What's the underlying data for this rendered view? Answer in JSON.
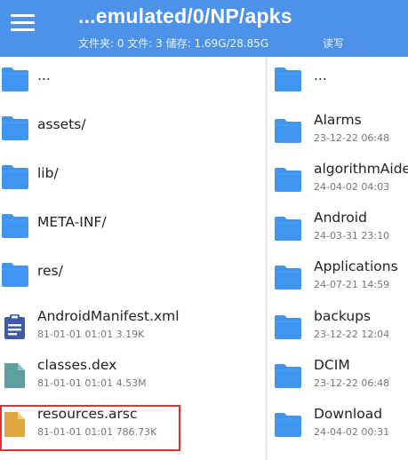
{
  "header": {
    "menu_icon": "hamburger-menu-icon",
    "path": "...emulated/0/NP/apks",
    "info": "文件夹: 0 文件: 3 储存: 1.69G/28.85G",
    "rw": "读写",
    "colors": {
      "bar": "#4C92EA",
      "folder": "#3F95F0",
      "manifest": "#3E5BA8",
      "dex": "#5E9EA0",
      "arsc": "#E0A63E",
      "highlight": "#E0322F"
    }
  },
  "left": {
    "items": [
      {
        "name": "...",
        "meta": "",
        "icon": "folder-icon"
      },
      {
        "name": "assets/",
        "meta": "",
        "icon": "folder-icon"
      },
      {
        "name": "lib/",
        "meta": "",
        "icon": "folder-icon"
      },
      {
        "name": "META-INF/",
        "meta": "",
        "icon": "folder-icon"
      },
      {
        "name": "res/",
        "meta": "",
        "icon": "folder-icon"
      },
      {
        "name": "AndroidManifest.xml",
        "meta": "81-01-01 01:01  3.19K",
        "icon": "manifest-file-icon"
      },
      {
        "name": "classes.dex",
        "meta": "81-01-01 01:01  4.53M",
        "icon": "dex-file-icon"
      },
      {
        "name": "resources.arsc",
        "meta": "81-01-01 01:01  786.73K",
        "icon": "arsc-file-icon"
      }
    ]
  },
  "right": {
    "items": [
      {
        "name": "...",
        "meta": ""
      },
      {
        "name": "Alarms",
        "meta": "23-12-22 06:48"
      },
      {
        "name": "algorithmAide",
        "meta": "24-04-02 04:03"
      },
      {
        "name": "Android",
        "meta": "24-03-31 23:10"
      },
      {
        "name": "Applications",
        "meta": "24-07-21 14:59"
      },
      {
        "name": "backups",
        "meta": "23-12-22 12:04"
      },
      {
        "name": "DCIM",
        "meta": "23-12-22 06:48"
      },
      {
        "name": "Download",
        "meta": "24-04-02 00:31"
      }
    ]
  }
}
